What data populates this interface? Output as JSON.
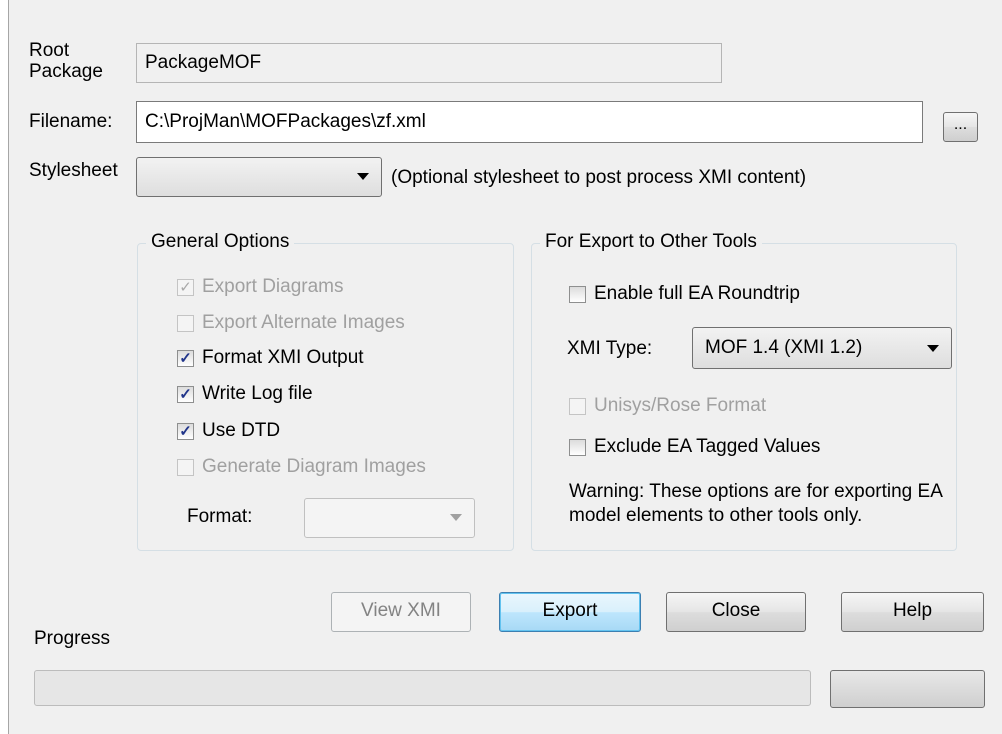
{
  "root_package": {
    "label": "Root\nPackage",
    "value": "PackageMOF"
  },
  "filename": {
    "label": "Filename:",
    "value": "C:\\ProjMan\\MOFPackages\\zf.xml",
    "browse_label": "..."
  },
  "stylesheet": {
    "label": "Stylesheet",
    "selected": "",
    "hint": "(Optional stylesheet to post process XMI content)"
  },
  "general_options": {
    "title": "General Options",
    "items": [
      {
        "label": "Export Diagrams",
        "checked": true,
        "enabled": false
      },
      {
        "label": "Export Alternate Images",
        "checked": false,
        "enabled": false
      },
      {
        "label": "Format XMI Output",
        "checked": true,
        "enabled": true
      },
      {
        "label": "Write Log file",
        "checked": true,
        "enabled": true
      },
      {
        "label": "Use DTD",
        "checked": true,
        "enabled": true
      },
      {
        "label": "Generate Diagram Images",
        "checked": false,
        "enabled": false
      }
    ],
    "format_label": "Format:",
    "format_selected": ""
  },
  "export_options": {
    "title": "For Export to Other Tools",
    "roundtrip": {
      "label": "Enable full EA Roundtrip",
      "checked": false,
      "enabled": true
    },
    "xmi_type_label": "XMI Type:",
    "xmi_type_selected": "MOF 1.4 (XMI 1.2)",
    "unisys": {
      "label": "Unisys/Rose Format",
      "checked": false,
      "enabled": false
    },
    "exclude_tagged": {
      "label": "Exclude EA Tagged Values",
      "checked": false,
      "enabled": true
    },
    "warning": "Warning: These options are for exporting EA model elements to other tools only."
  },
  "buttons": {
    "view_xmi": "View XMI",
    "export": "Export",
    "close": "Close",
    "help": "Help"
  },
  "progress": {
    "label": "Progress",
    "value": 0
  }
}
